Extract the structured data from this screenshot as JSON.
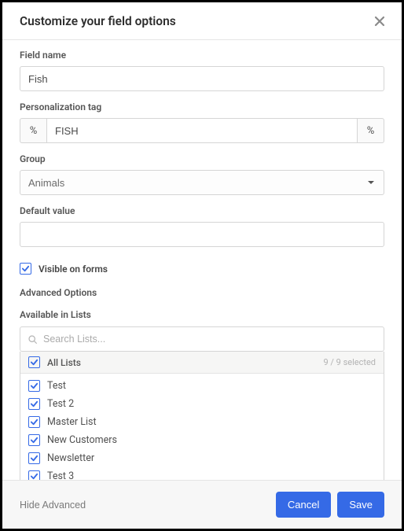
{
  "modal": {
    "title": "Customize your field options"
  },
  "fields": {
    "field_name": {
      "label": "Field name",
      "value": "Fish"
    },
    "ptag": {
      "label": "Personalization tag",
      "value": "FISH",
      "addon": "%"
    },
    "group": {
      "label": "Group",
      "value": "Animals"
    },
    "default_value": {
      "label": "Default value",
      "value": ""
    }
  },
  "visible_forms": {
    "label": "Visible on forms",
    "checked": true
  },
  "advanced": {
    "heading": "Advanced Options",
    "available_label": "Available in Lists",
    "search_placeholder": "Search Lists...",
    "all_lists_label": "All Lists",
    "selected_text": "9 / 9 selected",
    "items": [
      {
        "name": "Test",
        "checked": true
      },
      {
        "name": "Test 2",
        "checked": true
      },
      {
        "name": "Master List",
        "checked": true
      },
      {
        "name": "New Customers",
        "checked": true
      },
      {
        "name": "Newsletter",
        "checked": true
      },
      {
        "name": "Test 3",
        "checked": true
      }
    ]
  },
  "footer": {
    "hide_advanced": "Hide Advanced",
    "cancel": "Cancel",
    "save": "Save"
  }
}
